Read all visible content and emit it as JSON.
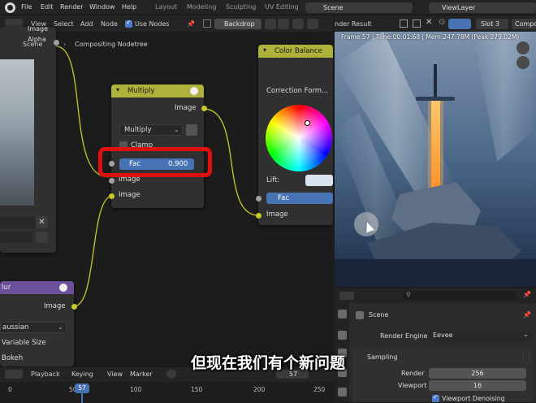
{
  "menu": [
    "File",
    "Edit",
    "Render",
    "Window",
    "Help"
  ],
  "workspaces": [
    "Layout",
    "Modeling",
    "Sculpting",
    "UV Editing"
  ],
  "scene_field": "Scene",
  "viewlayer_field": "ViewLayer",
  "node_header": {
    "items": [
      "View",
      "Select",
      "Add",
      "Node"
    ],
    "use_nodes_label": "Use Nodes",
    "backdrop_label": "Backdrop"
  },
  "breadcrumb": [
    "Scene",
    "Compositing Nodetree"
  ],
  "render_header": {
    "title": "nder Result",
    "slot": "Slot 3",
    "compo": "Compo",
    "frame_info": "Frame:57 | Time:00:01.68 | Mem:247.78M (Peak 279.02M)"
  },
  "left_node": {
    "socket_image": "Image",
    "socket_alpha": "Alpha"
  },
  "multiply_node": {
    "title": "Multiply",
    "output": "Image",
    "blend_mode": "Multiply",
    "clamp_label": "Clamp",
    "fac_label": "Fac",
    "fac_value": "0.900",
    "input1": "Image",
    "input2": "Image"
  },
  "color_balance_node": {
    "title": "Color Balance",
    "correction_label": "Correction Form...",
    "lift_label": "Lift:",
    "fac_label": "Fac",
    "input": "Image"
  },
  "blur_node": {
    "title": "lur",
    "output": "Image",
    "filter": "aussian",
    "variable_size": "Variable Size",
    "bokeh": "Bokeh"
  },
  "properties": {
    "scene_label": "Scene",
    "render_engine_label": "Render Engine",
    "render_engine_value": "Eevee",
    "sampling_label": "Sampling",
    "render_label": "Render",
    "render_value": "256",
    "viewport_label": "Viewport",
    "viewport_value": "16",
    "denoise_label": "Viewport Denoising"
  },
  "timeline": {
    "menu": [
      "Playback",
      "Keying",
      "View",
      "Marker"
    ],
    "current_frame": "57",
    "frame_field": "57",
    "ticks": [
      "0",
      "50",
      "100",
      "150",
      "200",
      "250"
    ]
  },
  "subtitle": "但现在我们有个新问题",
  "colors": {
    "accent": "#4d7cc6",
    "link": "#c7c729",
    "highlight": "#e01010"
  }
}
